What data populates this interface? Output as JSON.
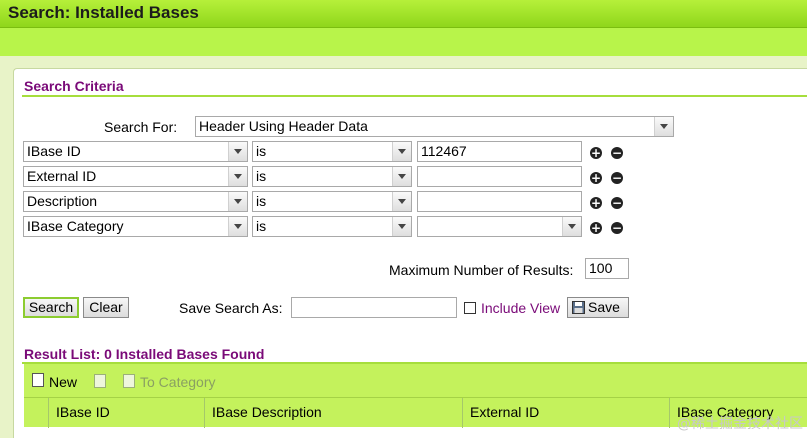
{
  "window": {
    "title": "Search: Installed Bases"
  },
  "criteria": {
    "heading": "Search Criteria",
    "search_for_label": "Search For:",
    "search_for_value": "Header Using Header Data",
    "rows": [
      {
        "field": "IBase ID",
        "operator": "is",
        "value": "112467",
        "value_type": "text"
      },
      {
        "field": "External ID",
        "operator": "is",
        "value": "",
        "value_type": "text"
      },
      {
        "field": "Description",
        "operator": "is",
        "value": "",
        "value_type": "text"
      },
      {
        "field": "IBase Category",
        "operator": "is",
        "value": "",
        "value_type": "dropdown"
      }
    ],
    "add_icon": "plus-circle-icon",
    "remove_icon": "minus-circle-icon",
    "max_results_label": "Maximum Number of Results:",
    "max_results_value": "100",
    "search_button": "Search",
    "clear_button": "Clear",
    "save_search_label": "Save Search As:",
    "save_search_value": "",
    "include_view_label": "Include View",
    "include_view_checked": false,
    "save_button": "Save"
  },
  "results": {
    "heading": "Result List: 0 Installed Bases Found",
    "toolbar": {
      "new_label": "New",
      "to_category_label": "To Category"
    },
    "columns": [
      "IBase ID",
      "IBase Description",
      "External ID",
      "IBase Category"
    ]
  },
  "watermark": "@稀土掘金技术社区",
  "colors": {
    "header_green": "#a6e22e",
    "section_purple": "#7a0a78",
    "table_green": "#c4f25c"
  }
}
